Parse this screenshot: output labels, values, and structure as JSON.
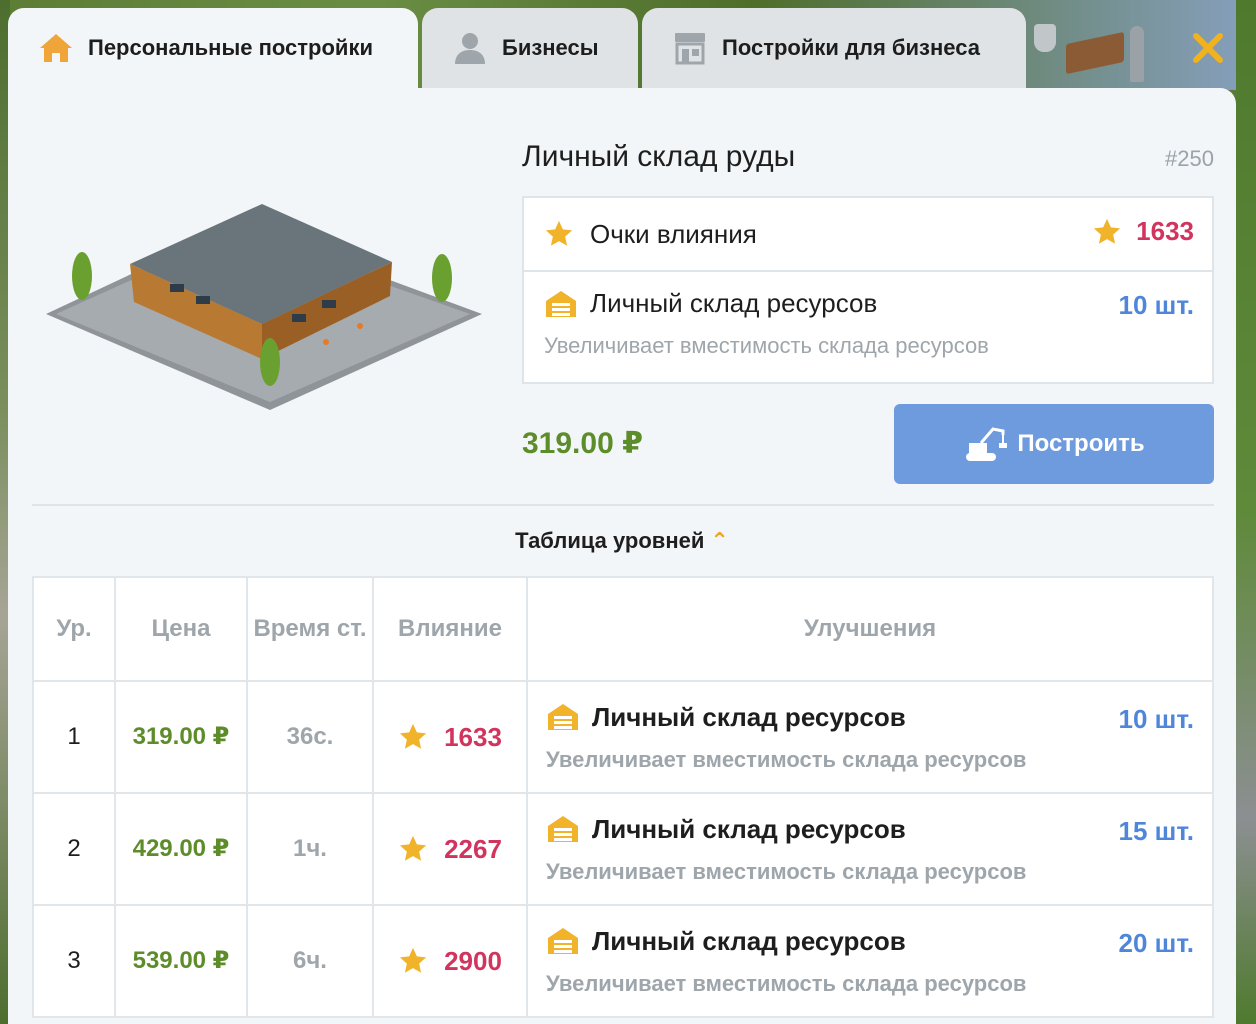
{
  "tabs": [
    {
      "label": "Персональные постройки",
      "icon": "home-icon",
      "active": true
    },
    {
      "label": "Бизнесы",
      "icon": "person-icon",
      "active": false
    },
    {
      "label": "Постройки для бизнеса",
      "icon": "store-icon",
      "active": false
    }
  ],
  "close_icon": "close-icon",
  "building": {
    "title": "Личный склад руды",
    "id": "#250",
    "influence_label": "Очки влияния",
    "influence_value": "1633",
    "storage_label": "Личный склад ресурсов",
    "storage_qty": "10 шт.",
    "storage_desc": "Увеличивает вместимость склада ресурсов",
    "price": "319.00 ₽",
    "build_label": "Построить"
  },
  "levels_toggle": "Таблица уровней",
  "table": {
    "headers": {
      "level": "Ур.",
      "price": "Цена",
      "time": "Время ст.",
      "influence": "Влияние",
      "upgrades": "Улучшения"
    },
    "rows": [
      {
        "level": "1",
        "price": "319.00 ₽",
        "time": "36с.",
        "influence": "1633",
        "upgrade": "Личный склад ресурсов",
        "qty": "10 шт.",
        "desc": "Увеличивает вместимость склада ресурсов"
      },
      {
        "level": "2",
        "price": "429.00 ₽",
        "time": "1ч.",
        "influence": "2267",
        "upgrade": "Личный склад ресурсов",
        "qty": "15 шт.",
        "desc": "Увеличивает вместимость склада ресурсов"
      },
      {
        "level": "3",
        "price": "539.00 ₽",
        "time": "6ч.",
        "influence": "2900",
        "upgrade": "Личный склад ресурсов",
        "qty": "20 шт.",
        "desc": "Увеличивает вместимость склада ресурсов"
      }
    ]
  },
  "colors": {
    "price_green": "#5d8d2a",
    "influence_red": "#d1355e",
    "qty_blue": "#4f86d9",
    "button_blue": "#6e9ade",
    "accent_yellow": "#e8a628"
  }
}
